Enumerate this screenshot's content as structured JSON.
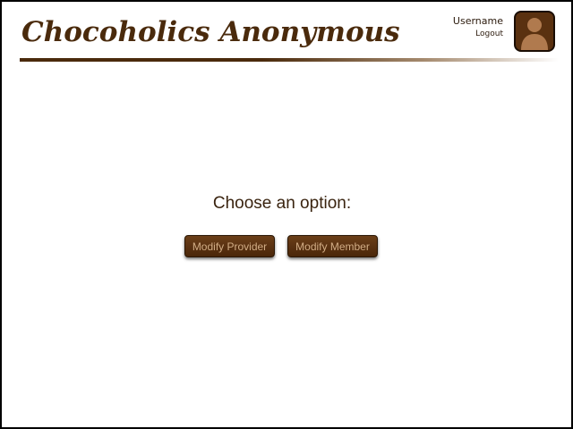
{
  "header": {
    "title": "Chocoholics Anonymous",
    "accent_color": "#4a2a0c"
  },
  "user": {
    "name": "Username",
    "logout_label": "Logout",
    "avatar_icon": "user-avatar-icon"
  },
  "main": {
    "prompt": "Choose an option:",
    "buttons": [
      {
        "label": "Modify Provider"
      },
      {
        "label": "Modify Member"
      }
    ]
  }
}
